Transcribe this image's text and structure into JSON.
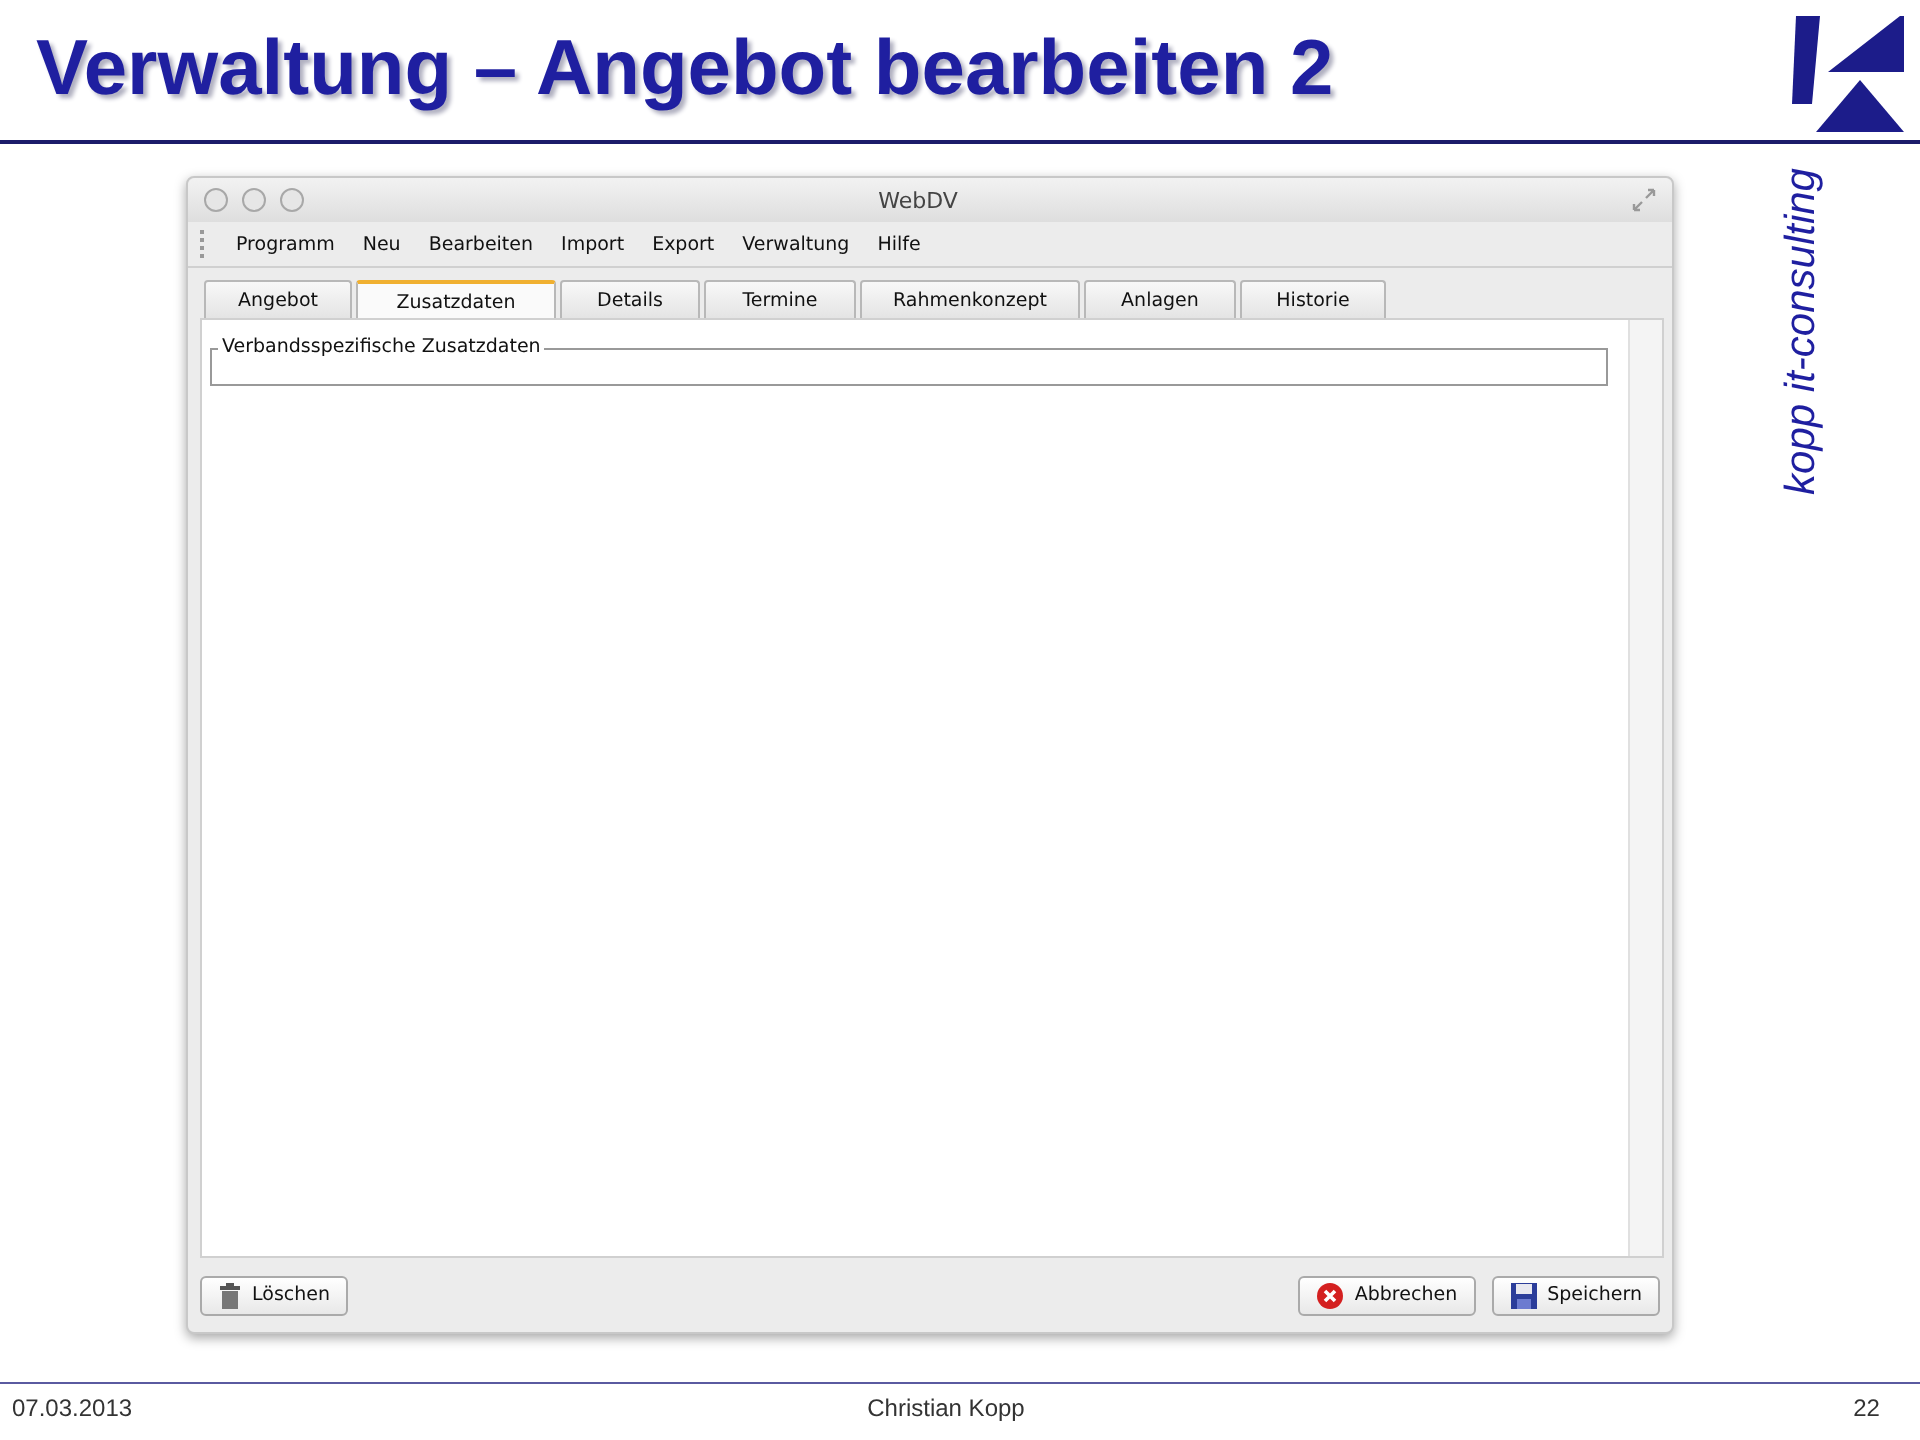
{
  "slide": {
    "title": "Verwaltung – Angebot bearbeiten 2",
    "brand": "kopp it-consulting"
  },
  "window": {
    "title": "WebDV"
  },
  "menu": [
    "Programm",
    "Neu",
    "Bearbeiten",
    "Import",
    "Export",
    "Verwaltung",
    "Hilfe"
  ],
  "tabs": [
    {
      "label": "Angebot",
      "selected": false
    },
    {
      "label": "Zusatzdaten",
      "selected": true
    },
    {
      "label": "Details",
      "selected": false
    },
    {
      "label": "Termine",
      "selected": false
    },
    {
      "label": "Rahmenkonzept",
      "selected": false
    },
    {
      "label": "Anlagen",
      "selected": false
    },
    {
      "label": "Historie",
      "selected": false
    }
  ],
  "group": {
    "legend": "Verbandsspezifische Zusatzdaten"
  },
  "buttons": [
    {
      "label": "Löschen",
      "kind": "delete"
    },
    {
      "label": "Abbrechen",
      "kind": "cancel"
    },
    {
      "label": "Speichern",
      "kind": "save"
    }
  ],
  "footer": {
    "date": "07.03.2013",
    "author": "Christian Kopp",
    "page": "22"
  }
}
